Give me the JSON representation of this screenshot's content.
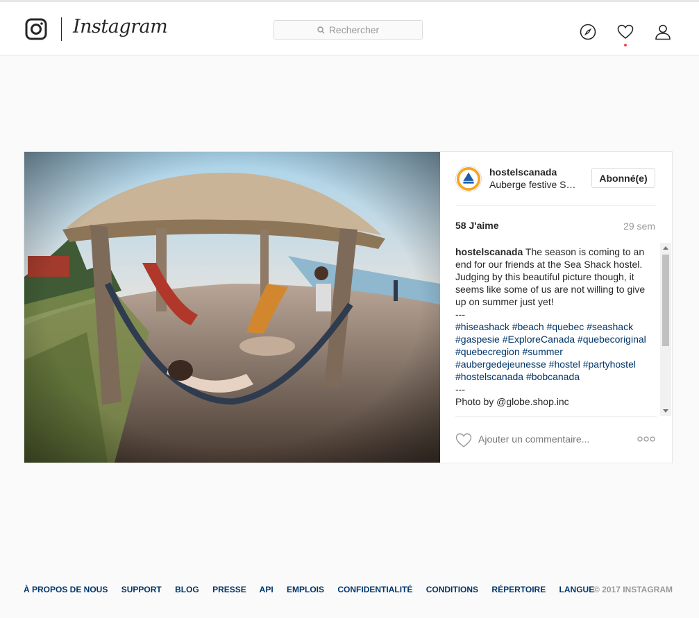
{
  "header": {
    "wordmark": "Instagram",
    "search_placeholder": "Rechercher"
  },
  "post": {
    "username": "hostelscanada",
    "location": "Auberge festive Sea Shack",
    "follow_label": "Abonné(e)",
    "likes": "58 J'aime",
    "age": "29 sem",
    "caption_user": "hostelscanada",
    "caption_text": "The season is coming to an end for our friends at the Sea Shack hostel. Judging by this beautiful picture though, it seems like some of us are not willing to give up on summer just yet!",
    "separator1": "---",
    "hashtags": "#hiseashack #beach #quebec #seashack #gaspesie #ExploreCanada #quebecoriginal #quebecregion #summer #aubergedejeunesse #hostel #partyhostel #hostelscanada #bobcanada",
    "separator2": "---",
    "photo_credit": "Photo by @globe.shop.inc",
    "comment_placeholder": "Ajouter un commentaire..."
  },
  "footer": {
    "links": [
      "À PROPOS DE NOUS",
      "SUPPORT",
      "BLOG",
      "PRESSE",
      "API",
      "EMPLOIS",
      "CONFIDENTIALITÉ",
      "CONDITIONS",
      "RÉPERTOIRE",
      "LANGUE"
    ],
    "copyright": "© 2017 INSTAGRAM"
  },
  "colors": {
    "link": "#003569",
    "notification": "#ed4956",
    "avatar_orange": "#f5a623"
  }
}
